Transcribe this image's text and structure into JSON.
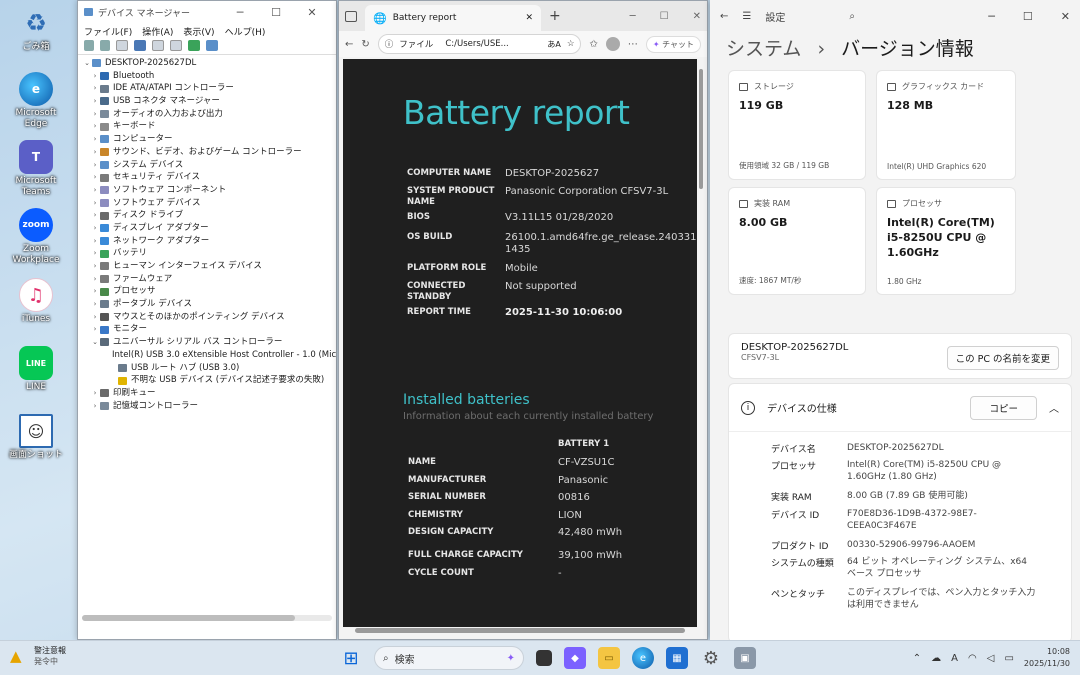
{
  "desktop": {
    "icons": [
      {
        "label": "ごみ箱"
      },
      {
        "label": "Microsoft Edge"
      },
      {
        "label": "Microsoft Teams"
      },
      {
        "label": "Zoom Workplace"
      },
      {
        "label": "iTunes"
      },
      {
        "label": "LINE"
      },
      {
        "label": "画面ショット"
      }
    ]
  },
  "devmgr": {
    "title": "デバイス マネージャー",
    "menu": [
      "ファイル(F)",
      "操作(A)",
      "表示(V)",
      "ヘルプ(H)"
    ],
    "root": "DESKTOP-2025627DL",
    "items": [
      "Bluetooth",
      "IDE ATA/ATAPI コントローラー",
      "USB コネクタ マネージャー",
      "オーディオの入力および出力",
      "キーボード",
      "コンピューター",
      "サウンド、ビデオ、およびゲーム コントローラー",
      "システム デバイス",
      "セキュリティ デバイス",
      "ソフトウェア コンポーネント",
      "ソフトウェア デバイス",
      "ディスク ドライブ",
      "ディスプレイ アダプター",
      "ネットワーク アダプター",
      "バッテリ",
      "ヒューマン インターフェイス デバイス",
      "ファームウェア",
      "プロセッサ",
      "ポータブル デバイス",
      "マウスとそのほかのポインティング デバイス",
      "モニター",
      "ユニバーサル シリアル バス コントローラー"
    ],
    "usb_children": [
      "Intel(R) USB 3.0 eXtensible Host Controller - 1.0 (Microsoft)",
      "USB ルート ハブ (USB 3.0)",
      "不明な USB デバイス (デバイス記述子要求の失敗)"
    ],
    "after": [
      "印刷キュー",
      "記憶域コントローラー"
    ]
  },
  "edge": {
    "tab_title": "Battery report",
    "url_prefix": "ファイル",
    "url": "C:/Users/USE...",
    "zoom_label": "あA",
    "chat": "チャット"
  },
  "report": {
    "title": "Battery report",
    "system": [
      {
        "k": "COMPUTER NAME",
        "v": "DESKTOP-2025627"
      },
      {
        "k": "SYSTEM PRODUCT NAME",
        "v": "Panasonic Corporation CFSV7-3L"
      },
      {
        "k": "BIOS",
        "v": "V3.11L15 01/28/2020"
      },
      {
        "k": "OS BUILD",
        "v": "26100.1.amd64fre.ge_release.240331-1435"
      },
      {
        "k": "PLATFORM ROLE",
        "v": "Mobile"
      },
      {
        "k": "CONNECTED STANDBY",
        "v": "Not supported"
      },
      {
        "k": "REPORT TIME",
        "v": "2025-11-30  10:06:00"
      }
    ],
    "installed_title": "Installed batteries",
    "installed_sub": "Information about each currently installed battery",
    "battery_header": "BATTERY 1",
    "battery": [
      {
        "k": "NAME",
        "v": "CF-VZSU1C"
      },
      {
        "k": "MANUFACTURER",
        "v": "Panasonic"
      },
      {
        "k": "SERIAL NUMBER",
        "v": "00816"
      },
      {
        "k": "CHEMISTRY",
        "v": "LION"
      },
      {
        "k": "DESIGN CAPACITY",
        "v": "42,480 mWh"
      },
      {
        "k": "FULL CHARGE CAPACITY",
        "v": "39,100 mWh"
      },
      {
        "k": "CYCLE COUNT",
        "v": "-"
      }
    ]
  },
  "settings": {
    "app": "設定",
    "crumb_parent": "システム",
    "crumb_sep": "›",
    "crumb_current": "バージョン情報",
    "cards": [
      {
        "title": "ストレージ",
        "value": "119 GB",
        "foot": "使用領域 32 GB / 119 GB"
      },
      {
        "title": "グラフィックス カード",
        "value": "128 MB",
        "foot": "Intel(R) UHD Graphics 620"
      },
      {
        "title": "実装 RAM",
        "value": "8.00 GB",
        "foot": "速度: 1867 MT/秒"
      },
      {
        "title": "プロセッサ",
        "value": "Intel(R) Core(TM) i5-8250U CPU @ 1.60GHz",
        "foot": "1.80 GHz"
      }
    ],
    "device_name": "DESKTOP-2025627DL",
    "device_model": "CFSV7-3L",
    "rename_button": "この PC の名前を変更",
    "spec_title": "デバイスの仕様",
    "copy_button": "コピー",
    "specs": [
      {
        "k": "デバイス名",
        "v": "DESKTOP-2025627DL"
      },
      {
        "k": "プロセッサ",
        "v": "Intel(R) Core(TM) i5-8250U CPU @ 1.60GHz (1.80 GHz)"
      },
      {
        "k": "実装 RAM",
        "v": "8.00 GB (7.89 GB 使用可能)"
      },
      {
        "k": "デバイス ID",
        "v": "F70E8D36-1D9B-4372-98E7-CEEA0C3F467E"
      },
      {
        "k": "プロダクト ID",
        "v": "00330-52906-99796-AAOEM"
      },
      {
        "k": "システムの種類",
        "v": "64 ビット オペレーティング システム、x64 ベース プロセッサ"
      },
      {
        "k": "ペンとタッチ",
        "v": "このディスプレイでは、ペン入力とタッチ入力は利用できません"
      }
    ]
  },
  "taskbar": {
    "weather_title": "警注意報",
    "weather_sub": "発令中",
    "search_placeholder": "検索",
    "ime": "A",
    "time": "10:08",
    "date": "2025/11/30"
  }
}
